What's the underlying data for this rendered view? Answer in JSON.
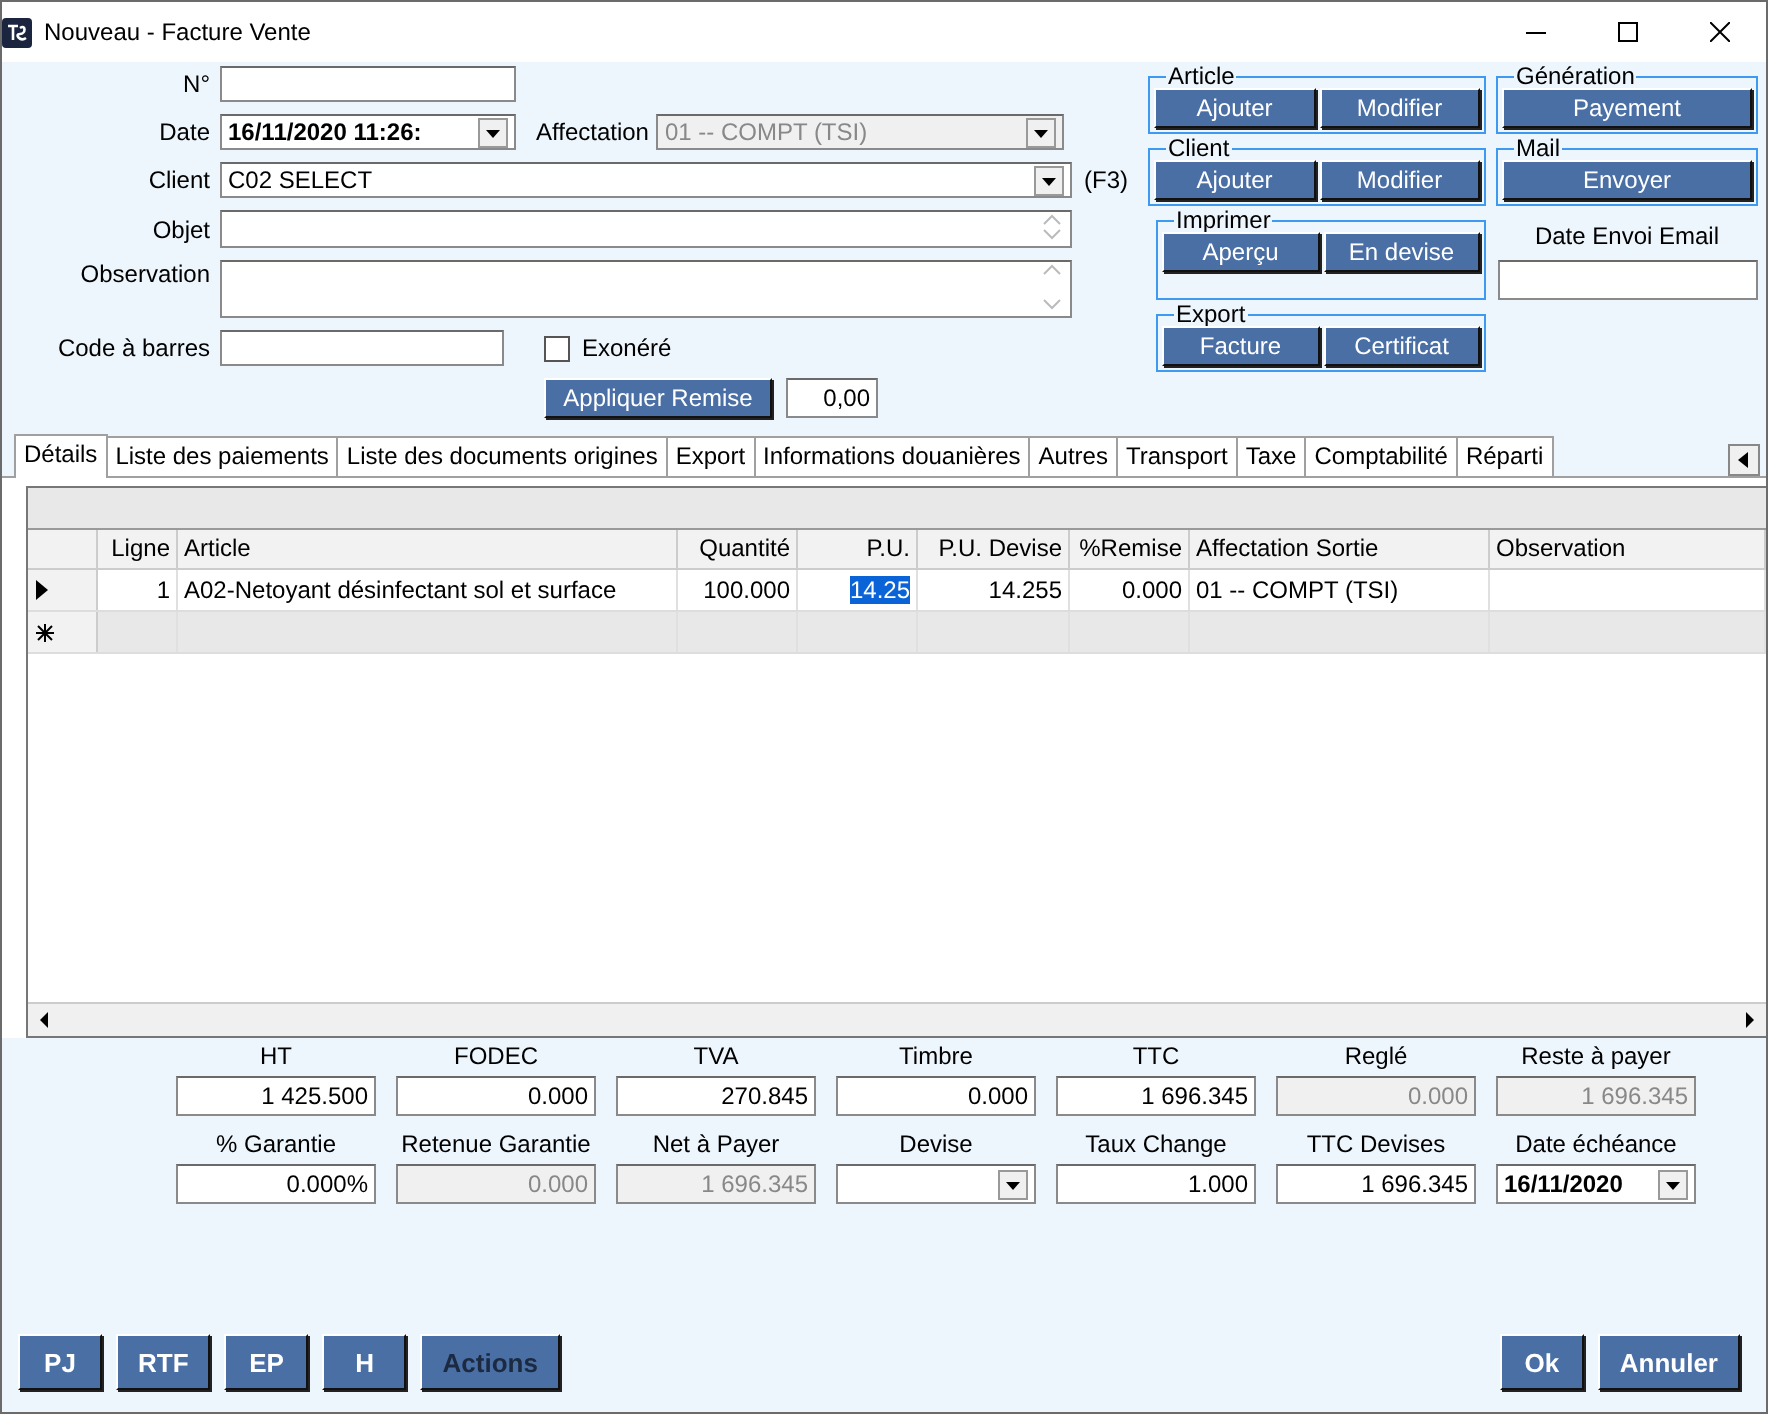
{
  "window": {
    "title": "Nouveau - Facture Vente"
  },
  "header": {
    "numero": {
      "label": "N°"
    },
    "date": {
      "label": "Date",
      "value": "16/11/2020 11:26:"
    },
    "affectation": {
      "label": "Affectation",
      "value": "01 -- COMPT (TSI)",
      "disabled": true
    },
    "client": {
      "label": "Client",
      "value": "C02 SELECT",
      "hint": "(F3)"
    },
    "objet": {
      "label": "Objet"
    },
    "observation": {
      "label": "Observation"
    },
    "code_barres": {
      "label": "Code à barres"
    },
    "exonere": {
      "label": "Exonéré",
      "checked": false
    },
    "remise": {
      "button": "Appliquer Remise",
      "value": "0,00"
    }
  },
  "panels": [
    {
      "kind": "buttons",
      "title": "Article",
      "buttons": [
        "Ajouter",
        "Modifier"
      ]
    },
    {
      "kind": "buttons",
      "title": "Génération",
      "buttons": [
        "Payement"
      ]
    },
    {
      "kind": "buttons",
      "title": "Client",
      "buttons": [
        "Ajouter",
        "Modifier"
      ]
    },
    {
      "kind": "buttons",
      "title": "Mail",
      "buttons": [
        "Envoyer"
      ]
    },
    {
      "kind": "buttons",
      "title": "Imprimer",
      "buttons": [
        "Aperçu",
        "En devise"
      ]
    },
    {
      "kind": "field",
      "label": "Date Envoi Email"
    },
    {
      "kind": "buttons",
      "title": "Export",
      "buttons": [
        "Facture",
        "Certificat"
      ]
    }
  ],
  "tabs": [
    {
      "label": "Détails",
      "selected": true
    },
    {
      "label": "Liste des paiements",
      "selected": false
    },
    {
      "label": "Liste des documents origines",
      "selected": false
    },
    {
      "label": "Export",
      "selected": false
    },
    {
      "label": "Informations douanières",
      "selected": false
    },
    {
      "label": "Autres",
      "selected": false
    },
    {
      "label": "Transport",
      "selected": false
    },
    {
      "label": "Taxe",
      "selected": false
    },
    {
      "label": "Comptabilité",
      "selected": false
    },
    {
      "label": "Réparti",
      "selected": false
    }
  ],
  "table": {
    "columns": [
      "Ligne",
      "Article",
      "Quantité",
      "P.U.",
      "P.U. Devise",
      "%Remise",
      "Affectation Sortie",
      "Observation"
    ],
    "rows": [
      {
        "current": true,
        "cells": [
          {
            "text": "1",
            "selected": false
          },
          {
            "text": "A02-Netoyant désinfectant sol et surface",
            "selected": false
          },
          {
            "text": "100.000",
            "selected": false
          },
          {
            "text": "14.25",
            "selected": true
          },
          {
            "text": "14.255",
            "selected": false
          },
          {
            "text": "0.000",
            "selected": false
          },
          {
            "text": "01 -- COMPT (TSI)",
            "selected": false
          }
        ]
      }
    ],
    "new_row": true
  },
  "totals": [
    {
      "label": "HT",
      "value": "1 425.500",
      "kind": "text",
      "disabled": false
    },
    {
      "label": "FODEC",
      "value": "0.000",
      "kind": "text",
      "disabled": false
    },
    {
      "label": "TVA",
      "value": "270.845",
      "kind": "text",
      "disabled": false
    },
    {
      "label": "Timbre",
      "value": "0.000",
      "kind": "text",
      "disabled": false
    },
    {
      "label": "TTC",
      "value": "1 696.345",
      "kind": "text",
      "disabled": false
    },
    {
      "label": "Reglé",
      "value": "0.000",
      "kind": "text",
      "disabled": true
    },
    {
      "label": "Reste à payer",
      "value": "1 696.345",
      "kind": "text",
      "disabled": true
    },
    {
      "label": "% Garantie",
      "value": "0.000%",
      "kind": "text",
      "disabled": false
    },
    {
      "label": "Retenue Garantie",
      "value": "0.000",
      "kind": "text",
      "disabled": true
    },
    {
      "label": "Net à Payer",
      "value": "1 696.345",
      "kind": "text",
      "disabled": true
    },
    {
      "label": "Devise",
      "kind": "combo",
      "disabled": false
    },
    {
      "label": "Taux Change",
      "value": "1.000",
      "kind": "text",
      "disabled": false
    },
    {
      "label": "TTC Devises",
      "value": "1 696.345",
      "kind": "text",
      "disabled": false
    },
    {
      "label": "Date échéance",
      "value": "16/11/2020",
      "kind": "date",
      "disabled": false
    }
  ],
  "footer": {
    "left": [
      {
        "label": "PJ",
        "disabled": false
      },
      {
        "label": "RTF",
        "disabled": false
      },
      {
        "label": "EP",
        "disabled": false
      },
      {
        "label": "H",
        "disabled": false
      },
      {
        "label": "Actions",
        "disabled": true
      }
    ],
    "right": [
      {
        "label": "Ok",
        "disabled": false
      },
      {
        "label": "Annuler",
        "disabled": false
      }
    ]
  }
}
